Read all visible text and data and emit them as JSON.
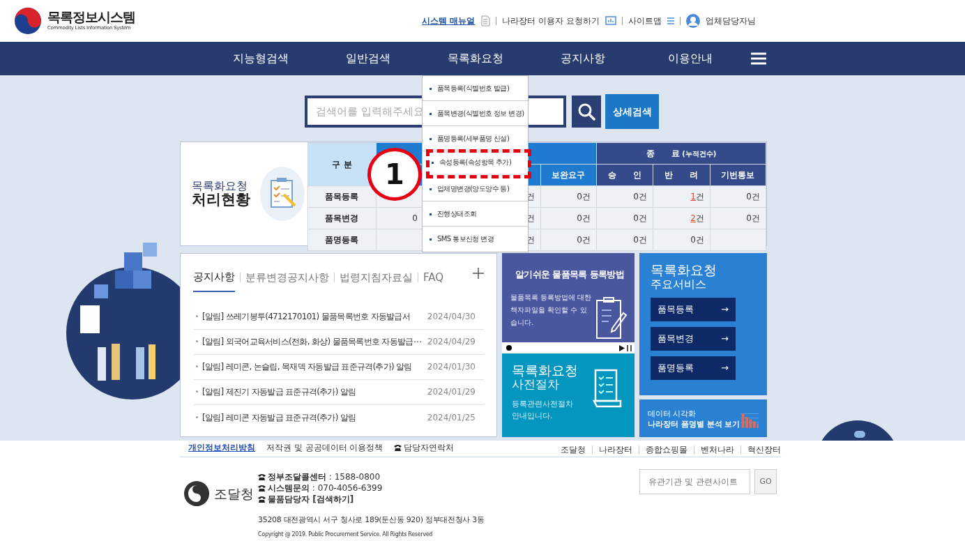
{
  "header": {
    "logo_title": "목록정보시스템",
    "logo_subtitle": "Commodity Lists Information System",
    "utility_links": [
      {
        "label": "시스템 매뉴얼",
        "kind": "manual"
      },
      {
        "label": "나라장터 이용자 요청하기",
        "kind": "request"
      },
      {
        "label": "사이트맵",
        "kind": "sitemap"
      }
    ],
    "user": "업체담당자님"
  },
  "nav": {
    "items": [
      {
        "label": "지능형검색"
      },
      {
        "label": "일반검색"
      },
      {
        "label": "목록화요청"
      },
      {
        "label": "공지사항"
      },
      {
        "label": "이용안내"
      }
    ]
  },
  "dropdown": {
    "items": [
      {
        "label": "품목등록(식별번호 발급)",
        "highlighted": false
      },
      {
        "label": "품목변경(식별번호 정보 변경)",
        "highlighted": false
      },
      {
        "label": "품명등록(세부품명 신설)",
        "highlighted": false
      },
      {
        "label": "속성등록(속성항목 추가)",
        "highlighted": true
      },
      {
        "label": "업체명변경(양도양수 등)",
        "highlighted": false
      },
      {
        "label": "진행상태조회",
        "highlighted": false
      },
      {
        "label": "SMS 통보신청 변경",
        "highlighted": false
      }
    ],
    "callout": "1"
  },
  "search": {
    "placeholder": "검색어를 입력해주세요",
    "detail_button": "상세검색"
  },
  "status": {
    "title_line1": "목록화요청",
    "title_line2": "처리현황",
    "table": {
      "row_header": "구 분",
      "group_2": {
        "label": "종　　료",
        "note": "(누적건수)"
      },
      "columns": [
        "",
        "",
        "보완요구",
        "승　　인",
        "반　　려",
        "기번통보"
      ],
      "rows": [
        {
          "label": "품목등록",
          "cells": [
            {
              "text": ""
            },
            {
              "text": "건"
            },
            {
              "text": "0건"
            },
            {
              "text": "0건"
            },
            {
              "link": "1",
              "text": "건"
            },
            {
              "text": "0건"
            }
          ]
        },
        {
          "label": "품목변경",
          "cells": [
            {
              "text": "0"
            },
            {
              "text": "건"
            },
            {
              "text": "0건"
            },
            {
              "text": "0건"
            },
            {
              "link": "2",
              "text": "건"
            },
            {
              "text": "0건"
            }
          ]
        },
        {
          "label": "품명등록",
          "cells": [
            {
              "text": ""
            },
            {
              "text": "건"
            },
            {
              "text": "0건"
            },
            {
              "text": "0건"
            },
            {
              "text": "0건"
            },
            {
              "text": ""
            }
          ]
        }
      ]
    }
  },
  "notices": {
    "tabs": [
      {
        "label": "공지사항",
        "selected": true
      },
      {
        "label": "분류변경공지사항",
        "selected": false
      },
      {
        "label": "법령지침자료실",
        "selected": false
      },
      {
        "label": "FAQ",
        "selected": false
      }
    ],
    "items": [
      {
        "title": "[알림] 쓰레기봉투(4712170101) 물품목록번호 자동발급서",
        "date": "2024/04/30"
      },
      {
        "title": "[알림] 외국어교육서비스(전화, 화상) 물품목록번호 자동발급⋯",
        "date": "2024/04/29"
      },
      {
        "title": "[알림] 레미콘, 논슬립, 목재덱 자동발급 표준규격(추가) 알림",
        "date": "2024/01/30"
      },
      {
        "title": "[알림] 제진기 자동발급 표준규격(추가) 알림",
        "date": "2024/01/29"
      },
      {
        "title": "[알림] 레미콘 자동발급 표준규격(추가) 알림",
        "date": "2024/01/25"
      }
    ]
  },
  "guide_card": {
    "title": "알기쉬운 물품목록 등록방법",
    "text": "물품목록 등록방법에 대한 책자파일을 확인할 수 있습니다."
  },
  "pre_card": {
    "title": "목록화요청",
    "subtitle": "사전절차",
    "text": "등록관련사전절차 안내입니다."
  },
  "services": {
    "title": "목록화요청",
    "subtitle": "주요서비스",
    "buttons": [
      {
        "label": "품목등록",
        "arrow": "→"
      },
      {
        "label": "품목변경",
        "arrow": "→"
      },
      {
        "label": "품명등록",
        "arrow": "→"
      }
    ]
  },
  "data_card": {
    "label": "데이터 시각화",
    "title": "나라장터 품명별 분석 보기"
  },
  "footer": {
    "links": [
      {
        "label": "개인정보처리방침",
        "kind": "primary"
      },
      {
        "label": "저작권 및 공공데이터 이용정책",
        "kind": "plain"
      },
      {
        "label": "담당자연락처",
        "kind": "phone"
      }
    ],
    "sites": [
      "조달청",
      "나라장터",
      "종합쇼핑몰",
      "벤처나라",
      "혁신장터"
    ],
    "org": "조달청",
    "contacts": [
      {
        "label": "정부조달콜센터",
        "value": " : 1588-0800"
      },
      {
        "label": "시스템문의",
        "value": " : 070-4056-6399"
      },
      {
        "label": "물품담당자 [검색하기]"
      }
    ],
    "address": "35208 대전광역시 서구 청사로 189(둔산동 920) 정부대전청사 3동",
    "copyright": "Copyright @ 2019. Public Procurement Service. All Rights Reserved",
    "site_search": {
      "placeholder": "유관기관 및 관련사이트",
      "button": "GO"
    }
  }
}
